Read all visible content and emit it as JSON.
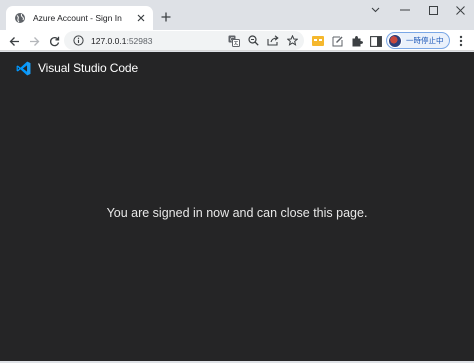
{
  "browser": {
    "tab": {
      "title": "Azure Account - Sign In",
      "favicon": "globe-icon"
    },
    "address_bar": {
      "host": "127.0.0.1",
      "port": ":52983",
      "info_icon": "info-icon"
    },
    "profile": {
      "status_label": "一時停止中"
    },
    "icons": {
      "back": "back-arrow-icon",
      "forward": "forward-arrow-icon",
      "reload": "reload-icon",
      "translate": "translate-icon",
      "zoom": "zoom-icon",
      "share": "share-icon",
      "bookmark": "star-icon",
      "extension_1": "extension-yellow-icon",
      "extension_2": "extension-edit-icon",
      "extensions": "puzzle-icon",
      "side_panel": "side-panel-icon",
      "menu": "kebab-menu-icon"
    }
  },
  "page": {
    "brand": "Visual Studio Code",
    "message": "You are signed in now and can close this page."
  },
  "colors": {
    "page_background": "#252526",
    "vscode_blue": "#0098ff",
    "tabstrip": "#dee1e6",
    "profile_text": "#1a56b8"
  }
}
